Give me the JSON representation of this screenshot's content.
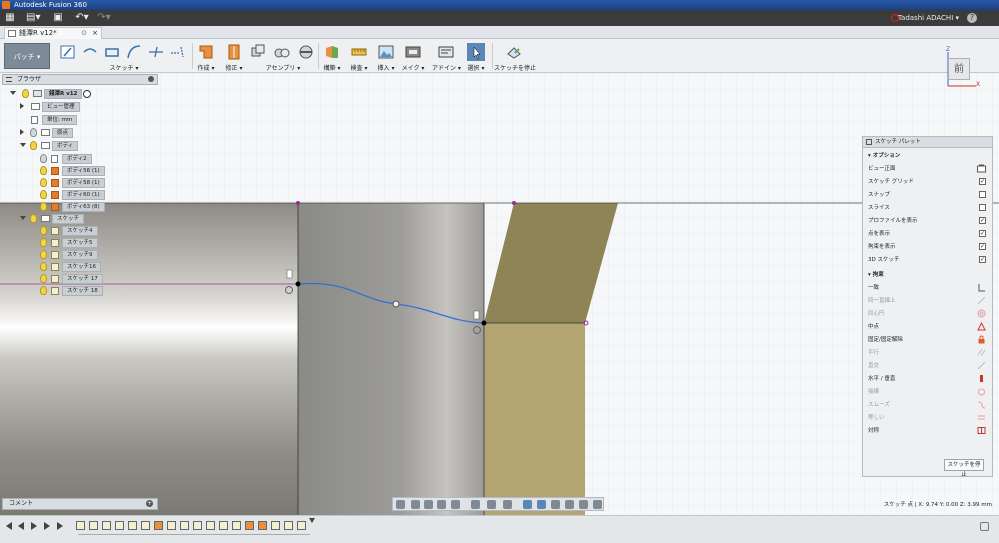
{
  "app": {
    "title": "Autodesk Fusion 360"
  },
  "qat": {
    "user": "Tadashi ADACHI ▾",
    "help": "?"
  },
  "document_tab": {
    "label": "錢潭R v12*"
  },
  "toolbar": {
    "workspace": "パッチ ▾",
    "groups": [
      {
        "label": "スケッチ ▾"
      },
      {
        "label": "作成 ▾"
      },
      {
        "label": "修正 ▾"
      },
      {
        "label": "アセンブリ ▾"
      },
      {
        "label": "構築 ▾"
      },
      {
        "label": "検査 ▾"
      },
      {
        "label": "挿入 ▾"
      },
      {
        "label": "メイク ▾"
      },
      {
        "label": "アドイン ▾"
      },
      {
        "label": "選択 ▾"
      },
      {
        "label": "スケッチを停止"
      }
    ]
  },
  "browser": {
    "title": "ブラウザ",
    "root": "錢潭R v12",
    "items": [
      {
        "label": "ビュー管理"
      },
      {
        "label": "単位: mm"
      },
      {
        "label": "原点"
      },
      {
        "label": "ボディ"
      },
      {
        "label": "ボディ2"
      },
      {
        "label": "ボディ56 (1)"
      },
      {
        "label": "ボディ58 (1)"
      },
      {
        "label": "ボディ60 (1)"
      },
      {
        "label": "ボディ63 (8)"
      },
      {
        "label": "スケッチ"
      },
      {
        "label": "スケッチ4"
      },
      {
        "label": "スケッチ5"
      },
      {
        "label": "スケッチ9"
      },
      {
        "label": "スケッチ16"
      },
      {
        "label": "スケッチ 17"
      },
      {
        "label": "スケッチ 18"
      }
    ]
  },
  "viewcube": {
    "face": "前",
    "axis_z": "Z",
    "axis_x": "X"
  },
  "palette": {
    "title": "スケッチ パレット",
    "options_title": "オプション",
    "options": [
      {
        "label": "ビュー正面",
        "checked": false,
        "icon": "look-at-icon"
      },
      {
        "label": "スケッチ グリッド",
        "checked": true
      },
      {
        "label": "スナップ",
        "checked": false
      },
      {
        "label": "スライス",
        "checked": false
      },
      {
        "label": "プロファイルを表示",
        "checked": true
      },
      {
        "label": "点を表示",
        "checked": true
      },
      {
        "label": "拘束を表示",
        "checked": true
      },
      {
        "label": "3D スケッチ",
        "checked": true
      }
    ],
    "constraints_title": "拘束",
    "constraints": [
      {
        "label": "一致",
        "enabled": true
      },
      {
        "label": "同一直線上",
        "enabled": false
      },
      {
        "label": "同心円",
        "enabled": false
      },
      {
        "label": "中点",
        "enabled": true
      },
      {
        "label": "固定/固定解除",
        "enabled": true
      },
      {
        "label": "平行",
        "enabled": false
      },
      {
        "label": "直交",
        "enabled": false
      },
      {
        "label": "水平 / 垂直",
        "enabled": true
      },
      {
        "label": "接線",
        "enabled": false
      },
      {
        "label": "スムーズ",
        "enabled": false
      },
      {
        "label": "等しい",
        "enabled": false
      },
      {
        "label": "対称",
        "enabled": true
      }
    ],
    "stop_button": "スケッチを停止"
  },
  "comment": {
    "label": "コメント"
  },
  "status": {
    "text": "スケッチ 点 | X: 9.74 Y: 0.00 Z: 3.99 mm"
  }
}
